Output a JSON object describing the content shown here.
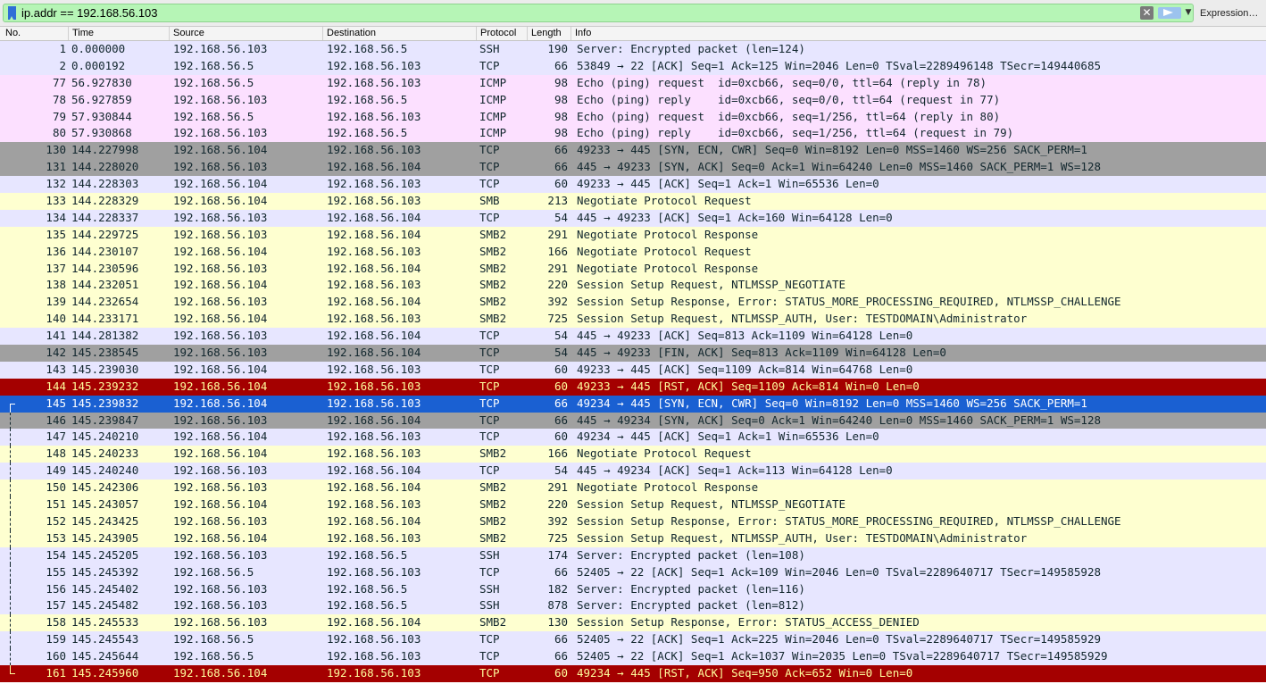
{
  "filter": {
    "value": "ip.addr == 192.168.56.103",
    "clear_icon": "x-icon",
    "apply_icon": "arrow-right-icon",
    "history_icon": "chevron-down-icon",
    "expression_label": "Expression…",
    "bg_color": "#b6f5b6"
  },
  "columns": [
    "No.",
    "Time",
    "Source",
    "Destination",
    "Protocol",
    "Length",
    "Info"
  ],
  "row_colors": {
    "tcp": {
      "bg": "#e7e6ff",
      "fg": "#12272e"
    },
    "icmp": {
      "bg": "#fce0ff",
      "fg": "#12272e"
    },
    "smb": {
      "bg": "#feffd0",
      "fg": "#12272e"
    },
    "bad": {
      "bg": "#a0a0a0",
      "fg": "#12272e"
    },
    "rst": {
      "bg": "#a40000",
      "fg": "#fffc9c"
    },
    "selected": {
      "bg": "#1a60d2",
      "fg": "#ffffff"
    }
  },
  "packets": [
    {
      "no": "1",
      "time": "0.000000",
      "src": "192.168.56.103",
      "dst": "192.168.56.5",
      "proto": "SSH",
      "len": "190",
      "info": "Server: Encrypted packet (len=124)",
      "style": "tcp",
      "conv": ""
    },
    {
      "no": "2",
      "time": "0.000192",
      "src": "192.168.56.5",
      "dst": "192.168.56.103",
      "proto": "TCP",
      "len": "66",
      "info": "53849 → 22 [ACK] Seq=1 Ack=125 Win=2046 Len=0 TSval=2289496148 TSecr=149440685",
      "style": "tcp",
      "conv": ""
    },
    {
      "no": "77",
      "time": "56.927830",
      "src": "192.168.56.5",
      "dst": "192.168.56.103",
      "proto": "ICMP",
      "len": "98",
      "info": "Echo (ping) request  id=0xcb66, seq=0/0, ttl=64 (reply in 78)",
      "style": "icmp",
      "conv": ""
    },
    {
      "no": "78",
      "time": "56.927859",
      "src": "192.168.56.103",
      "dst": "192.168.56.5",
      "proto": "ICMP",
      "len": "98",
      "info": "Echo (ping) reply    id=0xcb66, seq=0/0, ttl=64 (request in 77)",
      "style": "icmp",
      "conv": ""
    },
    {
      "no": "79",
      "time": "57.930844",
      "src": "192.168.56.5",
      "dst": "192.168.56.103",
      "proto": "ICMP",
      "len": "98",
      "info": "Echo (ping) request  id=0xcb66, seq=1/256, ttl=64 (reply in 80)",
      "style": "icmp",
      "conv": ""
    },
    {
      "no": "80",
      "time": "57.930868",
      "src": "192.168.56.103",
      "dst": "192.168.56.5",
      "proto": "ICMP",
      "len": "98",
      "info": "Echo (ping) reply    id=0xcb66, seq=1/256, ttl=64 (request in 79)",
      "style": "icmp",
      "conv": ""
    },
    {
      "no": "130",
      "time": "144.227998",
      "src": "192.168.56.104",
      "dst": "192.168.56.103",
      "proto": "TCP",
      "len": "66",
      "info": "49233 → 445 [SYN, ECN, CWR] Seq=0 Win=8192 Len=0 MSS=1460 WS=256 SACK_PERM=1",
      "style": "bad",
      "conv": ""
    },
    {
      "no": "131",
      "time": "144.228020",
      "src": "192.168.56.103",
      "dst": "192.168.56.104",
      "proto": "TCP",
      "len": "66",
      "info": "445 → 49233 [SYN, ACK] Seq=0 Ack=1 Win=64240 Len=0 MSS=1460 SACK_PERM=1 WS=128",
      "style": "bad",
      "conv": ""
    },
    {
      "no": "132",
      "time": "144.228303",
      "src": "192.168.56.104",
      "dst": "192.168.56.103",
      "proto": "TCP",
      "len": "60",
      "info": "49233 → 445 [ACK] Seq=1 Ack=1 Win=65536 Len=0",
      "style": "tcp",
      "conv": ""
    },
    {
      "no": "133",
      "time": "144.228329",
      "src": "192.168.56.104",
      "dst": "192.168.56.103",
      "proto": "SMB",
      "len": "213",
      "info": "Negotiate Protocol Request",
      "style": "smb",
      "conv": ""
    },
    {
      "no": "134",
      "time": "144.228337",
      "src": "192.168.56.103",
      "dst": "192.168.56.104",
      "proto": "TCP",
      "len": "54",
      "info": "445 → 49233 [ACK] Seq=1 Ack=160 Win=64128 Len=0",
      "style": "tcp",
      "conv": ""
    },
    {
      "no": "135",
      "time": "144.229725",
      "src": "192.168.56.103",
      "dst": "192.168.56.104",
      "proto": "SMB2",
      "len": "291",
      "info": "Negotiate Protocol Response",
      "style": "smb",
      "conv": ""
    },
    {
      "no": "136",
      "time": "144.230107",
      "src": "192.168.56.104",
      "dst": "192.168.56.103",
      "proto": "SMB2",
      "len": "166",
      "info": "Negotiate Protocol Request",
      "style": "smb",
      "conv": ""
    },
    {
      "no": "137",
      "time": "144.230596",
      "src": "192.168.56.103",
      "dst": "192.168.56.104",
      "proto": "SMB2",
      "len": "291",
      "info": "Negotiate Protocol Response",
      "style": "smb",
      "conv": ""
    },
    {
      "no": "138",
      "time": "144.232051",
      "src": "192.168.56.104",
      "dst": "192.168.56.103",
      "proto": "SMB2",
      "len": "220",
      "info": "Session Setup Request, NTLMSSP_NEGOTIATE",
      "style": "smb",
      "conv": ""
    },
    {
      "no": "139",
      "time": "144.232654",
      "src": "192.168.56.103",
      "dst": "192.168.56.104",
      "proto": "SMB2",
      "len": "392",
      "info": "Session Setup Response, Error: STATUS_MORE_PROCESSING_REQUIRED, NTLMSSP_CHALLENGE",
      "style": "smb",
      "conv": ""
    },
    {
      "no": "140",
      "time": "144.233171",
      "src": "192.168.56.104",
      "dst": "192.168.56.103",
      "proto": "SMB2",
      "len": "725",
      "info": "Session Setup Request, NTLMSSP_AUTH, User: TESTDOMAIN\\Administrator",
      "style": "smb",
      "conv": ""
    },
    {
      "no": "141",
      "time": "144.281382",
      "src": "192.168.56.103",
      "dst": "192.168.56.104",
      "proto": "TCP",
      "len": "54",
      "info": "445 → 49233 [ACK] Seq=813 Ack=1109 Win=64128 Len=0",
      "style": "tcp",
      "conv": ""
    },
    {
      "no": "142",
      "time": "145.238545",
      "src": "192.168.56.103",
      "dst": "192.168.56.104",
      "proto": "TCP",
      "len": "54",
      "info": "445 → 49233 [FIN, ACK] Seq=813 Ack=1109 Win=64128 Len=0",
      "style": "bad",
      "conv": ""
    },
    {
      "no": "143",
      "time": "145.239030",
      "src": "192.168.56.104",
      "dst": "192.168.56.103",
      "proto": "TCP",
      "len": "60",
      "info": "49233 → 445 [ACK] Seq=1109 Ack=814 Win=64768 Len=0",
      "style": "tcp",
      "conv": ""
    },
    {
      "no": "144",
      "time": "145.239232",
      "src": "192.168.56.104",
      "dst": "192.168.56.103",
      "proto": "TCP",
      "len": "60",
      "info": "49233 → 445 [RST, ACK] Seq=1109 Ack=814 Win=0 Len=0",
      "style": "rst",
      "conv": ""
    },
    {
      "no": "145",
      "time": "145.239832",
      "src": "192.168.56.104",
      "dst": "192.168.56.103",
      "proto": "TCP",
      "len": "66",
      "info": "49234 → 445 [SYN, ECN, CWR] Seq=0 Win=8192 Len=0 MSS=1460 WS=256 SACK_PERM=1",
      "style": "selected",
      "conv": "start"
    },
    {
      "no": "146",
      "time": "145.239847",
      "src": "192.168.56.103",
      "dst": "192.168.56.104",
      "proto": "TCP",
      "len": "66",
      "info": "445 → 49234 [SYN, ACK] Seq=0 Ack=1 Win=64240 Len=0 MSS=1460 SACK_PERM=1 WS=128",
      "style": "bad",
      "conv": "mid"
    },
    {
      "no": "147",
      "time": "145.240210",
      "src": "192.168.56.104",
      "dst": "192.168.56.103",
      "proto": "TCP",
      "len": "60",
      "info": "49234 → 445 [ACK] Seq=1 Ack=1 Win=65536 Len=0",
      "style": "tcp",
      "conv": "mid"
    },
    {
      "no": "148",
      "time": "145.240233",
      "src": "192.168.56.104",
      "dst": "192.168.56.103",
      "proto": "SMB2",
      "len": "166",
      "info": "Negotiate Protocol Request",
      "style": "smb",
      "conv": "mid"
    },
    {
      "no": "149",
      "time": "145.240240",
      "src": "192.168.56.103",
      "dst": "192.168.56.104",
      "proto": "TCP",
      "len": "54",
      "info": "445 → 49234 [ACK] Seq=1 Ack=113 Win=64128 Len=0",
      "style": "tcp",
      "conv": "mid"
    },
    {
      "no": "150",
      "time": "145.242306",
      "src": "192.168.56.103",
      "dst": "192.168.56.104",
      "proto": "SMB2",
      "len": "291",
      "info": "Negotiate Protocol Response",
      "style": "smb",
      "conv": "mid"
    },
    {
      "no": "151",
      "time": "145.243057",
      "src": "192.168.56.104",
      "dst": "192.168.56.103",
      "proto": "SMB2",
      "len": "220",
      "info": "Session Setup Request, NTLMSSP_NEGOTIATE",
      "style": "smb",
      "conv": "mid"
    },
    {
      "no": "152",
      "time": "145.243425",
      "src": "192.168.56.103",
      "dst": "192.168.56.104",
      "proto": "SMB2",
      "len": "392",
      "info": "Session Setup Response, Error: STATUS_MORE_PROCESSING_REQUIRED, NTLMSSP_CHALLENGE",
      "style": "smb",
      "conv": "mid"
    },
    {
      "no": "153",
      "time": "145.243905",
      "src": "192.168.56.104",
      "dst": "192.168.56.103",
      "proto": "SMB2",
      "len": "725",
      "info": "Session Setup Request, NTLMSSP_AUTH, User: TESTDOMAIN\\Administrator",
      "style": "smb",
      "conv": "mid"
    },
    {
      "no": "154",
      "time": "145.245205",
      "src": "192.168.56.103",
      "dst": "192.168.56.5",
      "proto": "SSH",
      "len": "174",
      "info": "Server: Encrypted packet (len=108)",
      "style": "tcp",
      "conv": "mid"
    },
    {
      "no": "155",
      "time": "145.245392",
      "src": "192.168.56.5",
      "dst": "192.168.56.103",
      "proto": "TCP",
      "len": "66",
      "info": "52405 → 22 [ACK] Seq=1 Ack=109 Win=2046 Len=0 TSval=2289640717 TSecr=149585928",
      "style": "tcp",
      "conv": "mid"
    },
    {
      "no": "156",
      "time": "145.245402",
      "src": "192.168.56.103",
      "dst": "192.168.56.5",
      "proto": "SSH",
      "len": "182",
      "info": "Server: Encrypted packet (len=116)",
      "style": "tcp",
      "conv": "mid"
    },
    {
      "no": "157",
      "time": "145.245482",
      "src": "192.168.56.103",
      "dst": "192.168.56.5",
      "proto": "SSH",
      "len": "878",
      "info": "Server: Encrypted packet (len=812)",
      "style": "tcp",
      "conv": "mid"
    },
    {
      "no": "158",
      "time": "145.245533",
      "src": "192.168.56.103",
      "dst": "192.168.56.104",
      "proto": "SMB2",
      "len": "130",
      "info": "Session Setup Response, Error: STATUS_ACCESS_DENIED",
      "style": "smb",
      "conv": "mid"
    },
    {
      "no": "159",
      "time": "145.245543",
      "src": "192.168.56.5",
      "dst": "192.168.56.103",
      "proto": "TCP",
      "len": "66",
      "info": "52405 → 22 [ACK] Seq=1 Ack=225 Win=2046 Len=0 TSval=2289640717 TSecr=149585929",
      "style": "tcp",
      "conv": "mid"
    },
    {
      "no": "160",
      "time": "145.245644",
      "src": "192.168.56.5",
      "dst": "192.168.56.103",
      "proto": "TCP",
      "len": "66",
      "info": "52405 → 22 [ACK] Seq=1 Ack=1037 Win=2035 Len=0 TSval=2289640717 TSecr=149585929",
      "style": "tcp",
      "conv": "mid"
    },
    {
      "no": "161",
      "time": "145.245960",
      "src": "192.168.56.104",
      "dst": "192.168.56.103",
      "proto": "TCP",
      "len": "60",
      "info": "49234 → 445 [RST, ACK] Seq=950 Ack=652 Win=0 Len=0",
      "style": "rst",
      "conv": "end"
    }
  ]
}
